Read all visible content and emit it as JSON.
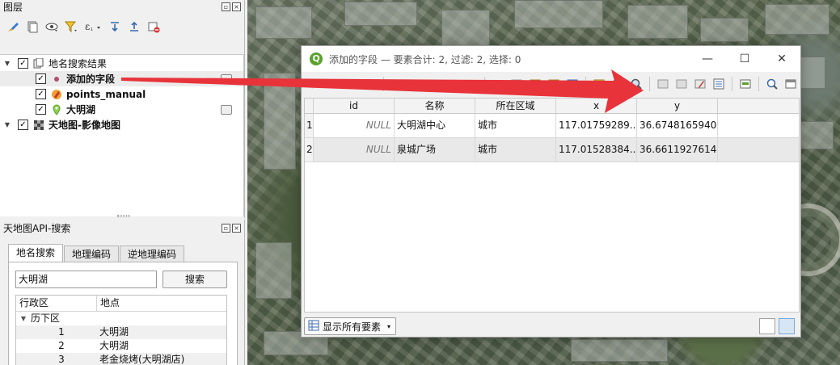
{
  "layers_panel": {
    "title": "图层",
    "tree": [
      {
        "name": "地名搜索结果",
        "level": 0,
        "expanded": true,
        "checked": true,
        "icon": "group-icon",
        "bold": false
      },
      {
        "name": "添加的字段",
        "level": 1,
        "checked": true,
        "icon": "point-dot-icon",
        "bold": true,
        "selected": true
      },
      {
        "name": "points_manual",
        "level": 1,
        "checked": true,
        "icon": "edit-pencil-icon",
        "bold": true
      },
      {
        "name": "大明湖",
        "level": 1,
        "checked": true,
        "icon": "map-pin-icon",
        "bold": true
      },
      {
        "name": "天地图-影像地图",
        "level": 0,
        "expanded": true,
        "checked": true,
        "icon": "raster-icon",
        "bold": true
      }
    ]
  },
  "search_panel": {
    "title": "天地图API-搜索",
    "tabs": [
      "地名搜索",
      "地理编码",
      "逆地理编码"
    ],
    "active_tab": 0,
    "input_value": "大明湖",
    "search_button": "搜索",
    "results_headers": [
      "行政区",
      "地点"
    ],
    "results_group": "历下区",
    "results": [
      {
        "index": "1",
        "place": "大明湖"
      },
      {
        "index": "2",
        "place": "大明湖"
      },
      {
        "index": "3",
        "place": "老金烧烤(大明湖店)"
      }
    ]
  },
  "attribute_table": {
    "window_title": "添加的字段 — 要素合计: 2, 过滤: 2, 选择: 0",
    "columns": [
      "id",
      "名称",
      "所在区域",
      "x",
      "y"
    ],
    "rows": [
      {
        "rownum": "1",
        "id": "NULL",
        "name": "大明湖中心",
        "area": "城市",
        "x": "117.01759289...",
        "y": "36.6748165940"
      },
      {
        "rownum": "2",
        "id": "NULL",
        "name": "泉城广场",
        "area": "城市",
        "x": "117.01528384...",
        "y": "36.6611927614"
      }
    ],
    "filter_button": "显示所有要素"
  },
  "colors": {
    "annotation_arrow": "#e8333a",
    "qgis_green": "#5aa02c",
    "selection_gray": "#ececec"
  }
}
